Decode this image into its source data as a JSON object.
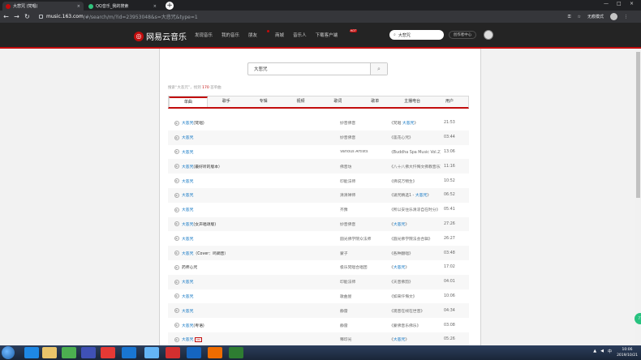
{
  "browser": {
    "tabs": [
      {
        "title": "大悲咒 (梵唱)",
        "close": "×",
        "color": "#c20c0c"
      },
      {
        "title": "QQ音乐_我的搜索",
        "close": "×",
        "color": "#31c27c"
      }
    ],
    "new_tab": "+",
    "window_controls": [
      "—",
      "□",
      "×"
    ],
    "url_host": "music.163.com",
    "url_path": "/#/search/m/?id=23953048&s=大悲咒&type=1",
    "profile_label": "无痕模式"
  },
  "header": {
    "logo_mark": "◎",
    "logo_text": "网易云音乐",
    "nav": [
      "发现音乐",
      "我的音乐",
      "朋友",
      "商城",
      "音乐人",
      "下载客户端"
    ],
    "hot_badge": "HOT",
    "search_text": "大悲咒",
    "creator_label": "创作者中心"
  },
  "search": {
    "query": "大悲咒",
    "summary_prefix": "搜索“大悲咒”，找到",
    "count": "170",
    "summary_suffix": "首单曲"
  },
  "tabs": [
    "单曲",
    "歌手",
    "专辑",
    "视频",
    "歌词",
    "歌单",
    "主播电台",
    "用户"
  ],
  "songs": [
    {
      "hl": "大悲咒",
      "rest": "(梵唱)",
      "mv": false,
      "artist": "妙音佛音",
      "album_pre": "《梵唱 ",
      "album_hl": "大悲咒",
      "album_post": "》",
      "duration": "21:53"
    },
    {
      "hl": "大悲咒",
      "rest": "",
      "mv": false,
      "artist": "妙音佛音",
      "album_pre": "《莲花心咒》",
      "album_hl": "",
      "album_post": "",
      "duration": "03:44"
    },
    {
      "hl": "大悲咒",
      "rest": "",
      "mv": false,
      "artist": "Various Artists",
      "album_pre": "《Buddha Spa Music Vol.2》",
      "album_hl": "",
      "album_post": "",
      "duration": "13:06"
    },
    {
      "hl": "大悲咒",
      "rest": "(最好听的版本）",
      "mv": false,
      "artist": "佛音坊",
      "album_pre": "《八十八佛大忏悔文佛教音乐》",
      "album_hl": "",
      "album_post": "",
      "duration": "11:16"
    },
    {
      "hl": "大悲咒",
      "rest": "",
      "mv": false,
      "artist": "印能法师",
      "album_pre": "《佛说万物生》",
      "album_hl": "",
      "album_post": "",
      "duration": "10:52"
    },
    {
      "hl": "大悲咒",
      "rest": "",
      "mv": false,
      "artist": "清清禅师",
      "album_pre": "《诵咒精选1 - ",
      "album_hl": "大悲咒",
      "album_post": "》",
      "duration": "06:52"
    },
    {
      "hl": "大悲咒",
      "rest": "",
      "mv": false,
      "artist": "齐豫",
      "album_pre": "《所以安住乐清凉自在时分》",
      "album_hl": "",
      "album_post": "",
      "duration": "05:41"
    },
    {
      "hl": "大悲咒",
      "rest": "(女声唱颂版)",
      "mv": false,
      "artist": "妙音佛音",
      "album_pre": "《",
      "album_hl": "大悲咒",
      "album_post": "》",
      "duration": "27:26"
    },
    {
      "hl": "大悲咒",
      "rest": "",
      "mv": false,
      "artist": "圆光佛学院众法师",
      "album_pre": "《圆光佛学院法会合辑》",
      "album_hl": "",
      "album_post": "",
      "duration": "26:27"
    },
    {
      "hl": "大悲咒",
      "rest": "（Cover：鸣蜩音）",
      "mv": false,
      "artist": "蒙子",
      "album_pre": "《各种翻唱》",
      "album_hl": "",
      "album_post": "",
      "duration": "03:48"
    },
    {
      "hl": "",
      "rest": "药师心咒",
      "mv": false,
      "artist": "极乐梵唱合唱团",
      "album_pre": "《",
      "album_hl": "大悲咒",
      "album_post": "》",
      "duration": "17:02"
    },
    {
      "hl": "大悲咒",
      "rest": "",
      "mv": false,
      "artist": "印能法师",
      "album_pre": "《天音佛韵》",
      "album_hl": "",
      "album_post": "",
      "duration": "04:01"
    },
    {
      "hl": "大悲咒",
      "rest": "",
      "mv": false,
      "artist": "歌曲屋",
      "album_pre": "《如来忏悔文》",
      "album_hl": "",
      "album_post": "",
      "duration": "10:06"
    },
    {
      "hl": "大悲咒",
      "rest": "",
      "mv": false,
      "artist": "静雷",
      "album_pre": "《观音在线在世音》",
      "album_hl": "",
      "album_post": "",
      "duration": "04:34"
    },
    {
      "hl": "大悲咒",
      "rest": "(粤语)",
      "mv": false,
      "artist": "静雷",
      "album_pre": "《蒙佛音乐佛乐》",
      "album_hl": "",
      "album_post": "",
      "duration": "03:08"
    },
    {
      "hl": "大悲咒",
      "rest": "",
      "mv": true,
      "artist": "释印光",
      "album_pre": "《",
      "album_hl": "大悲咒",
      "album_post": "》",
      "duration": "05:26"
    }
  ],
  "mv_badge": "MV",
  "play_glyph": "▶",
  "bubble": "77",
  "taskbar": {
    "tray_lang": "中",
    "time": "10:06",
    "date": "2019/10/21"
  },
  "colors": {
    "accent": "#c20c0c",
    "link": "#0c73c2",
    "header_bg": "#242424"
  }
}
